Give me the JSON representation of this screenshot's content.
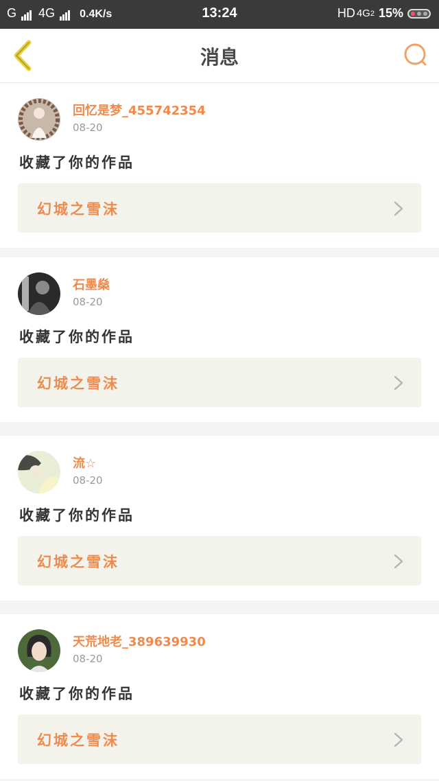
{
  "status_bar": {
    "carrier": "G",
    "network": "4G",
    "net_speed": "0.4K/s",
    "time": "13:24",
    "hd": "HD",
    "net_type": "4G",
    "sim_slot": "2",
    "battery": "15%"
  },
  "header": {
    "title": "消息",
    "back_icon": "chevron-left-icon",
    "search_icon": "search-icon",
    "accent_color": "#f3a064",
    "back_color": "#e8d23a"
  },
  "messages": [
    {
      "username": "回忆是梦_455742354",
      "date": "08-20",
      "action": "收藏了你的作品",
      "work_title": "幻城之雪沫"
    },
    {
      "username": "石墨燊",
      "date": "08-20",
      "action": "收藏了你的作品",
      "work_title": "幻城之雪沫"
    },
    {
      "username": "流☆",
      "date": "08-20",
      "action": "收藏了你的作品",
      "work_title": "幻城之雪沫"
    },
    {
      "username": "天荒地老_389639930",
      "date": "08-20",
      "action": "收藏了你的作品",
      "work_title": "幻城之雪沫"
    }
  ],
  "colors": {
    "username": "#f08a4b",
    "work_title": "#f08a4b",
    "action_text": "#333333",
    "date": "#9a9a9a",
    "work_bg": "#f3f3ec"
  }
}
